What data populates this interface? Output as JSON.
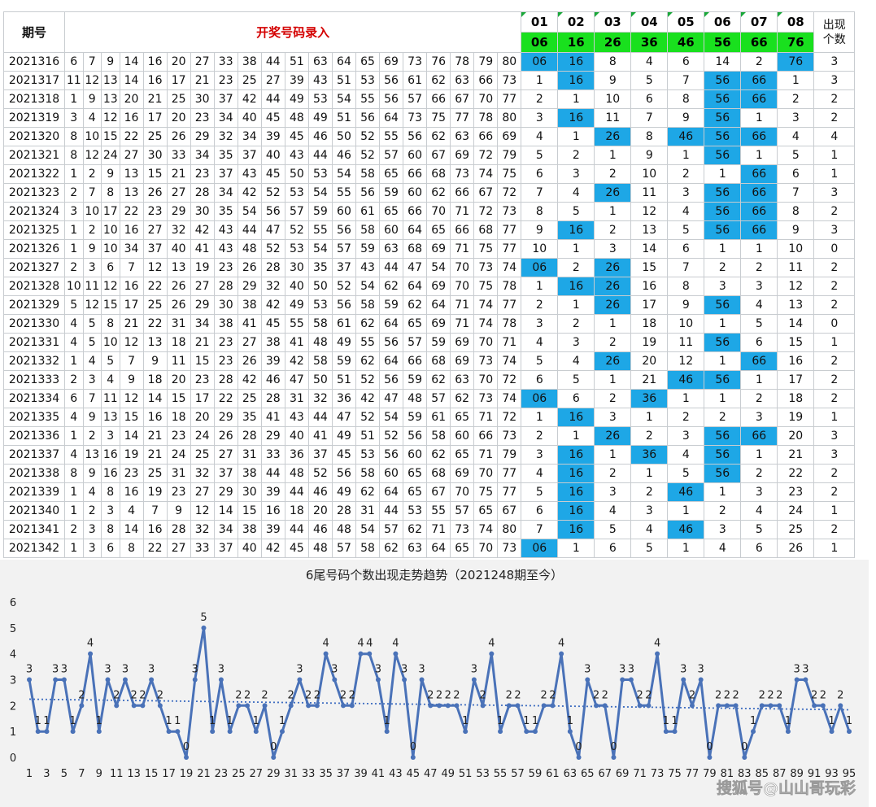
{
  "table": {
    "header_period": "期号",
    "header_input": "开奖号码录入",
    "header_count": "出现个数",
    "positions": [
      "01",
      "02",
      "03",
      "04",
      "05",
      "06",
      "07",
      "08"
    ],
    "tails": [
      "06",
      "16",
      "26",
      "36",
      "46",
      "56",
      "66",
      "76"
    ],
    "rows": [
      {
        "period": "2021316",
        "numbers": [
          "6",
          "7",
          "9",
          "14",
          "16",
          "20",
          "27",
          "33",
          "38",
          "44",
          "51",
          "63",
          "64",
          "65",
          "69",
          "73",
          "76",
          "78",
          "79",
          "80"
        ],
        "marks": [
          "06",
          "16",
          "8",
          "4",
          "6",
          "14",
          "2",
          "76"
        ],
        "count": "3"
      },
      {
        "period": "2021317",
        "numbers": [
          "11",
          "12",
          "13",
          "14",
          "16",
          "17",
          "21",
          "23",
          "25",
          "27",
          "39",
          "43",
          "51",
          "53",
          "56",
          "61",
          "62",
          "63",
          "66",
          "73"
        ],
        "marks": [
          "1",
          "16",
          "9",
          "5",
          "7",
          "56",
          "66",
          "1"
        ],
        "count": "3"
      },
      {
        "period": "2021318",
        "numbers": [
          "1",
          "9",
          "13",
          "20",
          "21",
          "25",
          "30",
          "37",
          "42",
          "44",
          "49",
          "53",
          "54",
          "55",
          "56",
          "57",
          "66",
          "67",
          "70",
          "77"
        ],
        "marks": [
          "2",
          "1",
          "10",
          "6",
          "8",
          "56",
          "66",
          "2"
        ],
        "count": "2"
      },
      {
        "period": "2021319",
        "numbers": [
          "3",
          "4",
          "12",
          "16",
          "17",
          "20",
          "23",
          "34",
          "40",
          "45",
          "48",
          "49",
          "51",
          "56",
          "64",
          "73",
          "75",
          "77",
          "78",
          "80"
        ],
        "marks": [
          "3",
          "16",
          "11",
          "7",
          "9",
          "56",
          "1",
          "3"
        ],
        "count": "2"
      },
      {
        "period": "2021320",
        "numbers": [
          "8",
          "10",
          "15",
          "22",
          "25",
          "26",
          "29",
          "32",
          "34",
          "39",
          "45",
          "46",
          "50",
          "52",
          "55",
          "56",
          "62",
          "63",
          "66",
          "69"
        ],
        "marks": [
          "4",
          "1",
          "26",
          "8",
          "46",
          "56",
          "66",
          "4"
        ],
        "count": "4"
      },
      {
        "period": "2021321",
        "numbers": [
          "8",
          "12",
          "24",
          "27",
          "30",
          "33",
          "34",
          "35",
          "37",
          "40",
          "43",
          "44",
          "46",
          "52",
          "57",
          "60",
          "67",
          "69",
          "72",
          "79"
        ],
        "marks": [
          "5",
          "2",
          "1",
          "9",
          "1",
          "56",
          "1",
          "5"
        ],
        "count": "1"
      },
      {
        "period": "2021322",
        "numbers": [
          "1",
          "2",
          "9",
          "13",
          "15",
          "21",
          "23",
          "37",
          "43",
          "45",
          "50",
          "53",
          "54",
          "58",
          "65",
          "66",
          "68",
          "73",
          "74",
          "75"
        ],
        "marks": [
          "6",
          "3",
          "2",
          "10",
          "2",
          "1",
          "66",
          "6"
        ],
        "count": "1"
      },
      {
        "period": "2021323",
        "numbers": [
          "2",
          "7",
          "8",
          "13",
          "26",
          "27",
          "28",
          "34",
          "42",
          "52",
          "53",
          "54",
          "55",
          "56",
          "59",
          "60",
          "62",
          "66",
          "67",
          "72"
        ],
        "marks": [
          "7",
          "4",
          "26",
          "11",
          "3",
          "56",
          "66",
          "7"
        ],
        "count": "3"
      },
      {
        "period": "2021324",
        "numbers": [
          "3",
          "10",
          "17",
          "22",
          "23",
          "29",
          "30",
          "35",
          "54",
          "56",
          "57",
          "59",
          "60",
          "61",
          "65",
          "66",
          "70",
          "71",
          "72",
          "73"
        ],
        "marks": [
          "8",
          "5",
          "1",
          "12",
          "4",
          "56",
          "66",
          "8"
        ],
        "count": "2"
      },
      {
        "period": "2021325",
        "numbers": [
          "1",
          "2",
          "10",
          "16",
          "27",
          "32",
          "42",
          "43",
          "44",
          "47",
          "52",
          "55",
          "56",
          "58",
          "60",
          "64",
          "65",
          "66",
          "68",
          "77"
        ],
        "marks": [
          "9",
          "16",
          "2",
          "13",
          "5",
          "56",
          "66",
          "9"
        ],
        "count": "3"
      },
      {
        "period": "2021326",
        "numbers": [
          "1",
          "9",
          "10",
          "34",
          "37",
          "40",
          "41",
          "43",
          "48",
          "52",
          "53",
          "54",
          "57",
          "59",
          "63",
          "68",
          "69",
          "71",
          "75",
          "77"
        ],
        "marks": [
          "10",
          "1",
          "3",
          "14",
          "6",
          "1",
          "1",
          "10"
        ],
        "count": "0"
      },
      {
        "period": "2021327",
        "numbers": [
          "2",
          "3",
          "6",
          "7",
          "12",
          "13",
          "19",
          "23",
          "26",
          "28",
          "30",
          "35",
          "37",
          "43",
          "44",
          "47",
          "54",
          "70",
          "73",
          "74"
        ],
        "marks": [
          "06",
          "2",
          "26",
          "15",
          "7",
          "2",
          "2",
          "11"
        ],
        "count": "2"
      },
      {
        "period": "2021328",
        "numbers": [
          "10",
          "11",
          "12",
          "16",
          "22",
          "26",
          "27",
          "28",
          "29",
          "32",
          "40",
          "50",
          "52",
          "54",
          "62",
          "64",
          "69",
          "70",
          "75",
          "78"
        ],
        "marks": [
          "1",
          "16",
          "26",
          "16",
          "8",
          "3",
          "3",
          "12"
        ],
        "count": "2"
      },
      {
        "period": "2021329",
        "numbers": [
          "5",
          "12",
          "15",
          "17",
          "25",
          "26",
          "29",
          "30",
          "38",
          "42",
          "49",
          "53",
          "56",
          "58",
          "59",
          "62",
          "64",
          "71",
          "74",
          "77"
        ],
        "marks": [
          "2",
          "1",
          "26",
          "17",
          "9",
          "56",
          "4",
          "13"
        ],
        "count": "2"
      },
      {
        "period": "2021330",
        "numbers": [
          "4",
          "5",
          "8",
          "21",
          "22",
          "31",
          "34",
          "38",
          "41",
          "45",
          "55",
          "58",
          "61",
          "62",
          "64",
          "65",
          "69",
          "71",
          "74",
          "78"
        ],
        "marks": [
          "3",
          "2",
          "1",
          "18",
          "10",
          "1",
          "5",
          "14"
        ],
        "count": "0"
      },
      {
        "period": "2021331",
        "numbers": [
          "4",
          "5",
          "10",
          "12",
          "13",
          "18",
          "21",
          "23",
          "27",
          "38",
          "41",
          "48",
          "49",
          "55",
          "56",
          "57",
          "59",
          "69",
          "70",
          "71"
        ],
        "marks": [
          "4",
          "3",
          "2",
          "19",
          "11",
          "56",
          "6",
          "15"
        ],
        "count": "1"
      },
      {
        "period": "2021332",
        "numbers": [
          "1",
          "4",
          "5",
          "7",
          "9",
          "11",
          "15",
          "23",
          "26",
          "39",
          "42",
          "58",
          "59",
          "62",
          "64",
          "66",
          "68",
          "69",
          "73",
          "74"
        ],
        "marks": [
          "5",
          "4",
          "26",
          "20",
          "12",
          "1",
          "66",
          "16"
        ],
        "count": "2"
      },
      {
        "period": "2021333",
        "numbers": [
          "2",
          "3",
          "4",
          "9",
          "18",
          "20",
          "23",
          "28",
          "42",
          "46",
          "47",
          "50",
          "51",
          "52",
          "56",
          "59",
          "62",
          "63",
          "70",
          "72"
        ],
        "marks": [
          "6",
          "5",
          "1",
          "21",
          "46",
          "56",
          "1",
          "17"
        ],
        "count": "2"
      },
      {
        "period": "2021334",
        "numbers": [
          "6",
          "7",
          "11",
          "12",
          "14",
          "15",
          "17",
          "22",
          "25",
          "28",
          "31",
          "32",
          "36",
          "42",
          "47",
          "48",
          "57",
          "62",
          "73",
          "74"
        ],
        "marks": [
          "06",
          "6",
          "2",
          "36",
          "1",
          "1",
          "2",
          "18"
        ],
        "count": "2"
      },
      {
        "period": "2021335",
        "numbers": [
          "4",
          "9",
          "13",
          "15",
          "16",
          "18",
          "20",
          "29",
          "35",
          "41",
          "43",
          "44",
          "47",
          "52",
          "54",
          "59",
          "61",
          "65",
          "71",
          "72"
        ],
        "marks": [
          "1",
          "16",
          "3",
          "1",
          "2",
          "2",
          "3",
          "19"
        ],
        "count": "1"
      },
      {
        "period": "2021336",
        "numbers": [
          "1",
          "2",
          "3",
          "14",
          "21",
          "23",
          "24",
          "26",
          "28",
          "29",
          "40",
          "41",
          "49",
          "51",
          "52",
          "56",
          "58",
          "60",
          "66",
          "73"
        ],
        "marks": [
          "2",
          "1",
          "26",
          "2",
          "3",
          "56",
          "66",
          "20"
        ],
        "count": "3"
      },
      {
        "period": "2021337",
        "numbers": [
          "4",
          "13",
          "16",
          "19",
          "21",
          "24",
          "25",
          "27",
          "31",
          "33",
          "36",
          "37",
          "45",
          "53",
          "56",
          "60",
          "62",
          "65",
          "71",
          "79"
        ],
        "marks": [
          "3",
          "16",
          "1",
          "36",
          "4",
          "56",
          "1",
          "21"
        ],
        "count": "3"
      },
      {
        "period": "2021338",
        "numbers": [
          "8",
          "9",
          "16",
          "23",
          "25",
          "31",
          "32",
          "37",
          "38",
          "44",
          "48",
          "52",
          "56",
          "58",
          "60",
          "65",
          "68",
          "69",
          "70",
          "77"
        ],
        "marks": [
          "4",
          "16",
          "2",
          "1",
          "5",
          "56",
          "2",
          "22"
        ],
        "count": "2"
      },
      {
        "period": "2021339",
        "numbers": [
          "1",
          "4",
          "8",
          "16",
          "19",
          "23",
          "27",
          "29",
          "30",
          "39",
          "44",
          "46",
          "49",
          "62",
          "64",
          "65",
          "67",
          "70",
          "75",
          "77"
        ],
        "marks": [
          "5",
          "16",
          "3",
          "2",
          "46",
          "1",
          "3",
          "23"
        ],
        "count": "2"
      },
      {
        "period": "2021340",
        "numbers": [
          "1",
          "2",
          "3",
          "4",
          "7",
          "9",
          "12",
          "14",
          "15",
          "16",
          "18",
          "20",
          "28",
          "31",
          "44",
          "53",
          "55",
          "57",
          "65",
          "67"
        ],
        "marks": [
          "6",
          "16",
          "4",
          "3",
          "1",
          "2",
          "4",
          "24"
        ],
        "count": "1"
      },
      {
        "period": "2021341",
        "numbers": [
          "2",
          "3",
          "8",
          "14",
          "16",
          "28",
          "32",
          "34",
          "38",
          "39",
          "44",
          "46",
          "48",
          "54",
          "57",
          "62",
          "71",
          "73",
          "74",
          "80"
        ],
        "marks": [
          "7",
          "16",
          "5",
          "4",
          "46",
          "3",
          "5",
          "25"
        ],
        "count": "2"
      },
      {
        "period": "2021342",
        "numbers": [
          "1",
          "3",
          "6",
          "8",
          "22",
          "27",
          "33",
          "37",
          "40",
          "42",
          "45",
          "48",
          "57",
          "58",
          "62",
          "63",
          "64",
          "65",
          "70",
          "73"
        ],
        "marks": [
          "06",
          "1",
          "6",
          "5",
          "1",
          "4",
          "6",
          "26"
        ],
        "count": "1"
      }
    ]
  },
  "colors": {
    "hit_cell": "#1ea7e6",
    "tail_header": "#19e01e",
    "input_header_text": "#d40000",
    "line": "#4a72b8",
    "trend": "#3d6cc0",
    "chart_bg": "#f2f2f2"
  },
  "watermark": "搜狐号@山山哥玩彩",
  "chart_data": {
    "type": "line",
    "title": "6尾号码个数出现走势趋势（2021248期至今）",
    "x": [
      1,
      2,
      3,
      4,
      5,
      6,
      7,
      8,
      9,
      10,
      11,
      12,
      13,
      14,
      15,
      16,
      17,
      18,
      19,
      20,
      21,
      22,
      23,
      24,
      25,
      26,
      27,
      28,
      29,
      30,
      31,
      32,
      33,
      34,
      35,
      36,
      37,
      38,
      39,
      40,
      41,
      42,
      43,
      44,
      45,
      46,
      47,
      48,
      49,
      50,
      51,
      52,
      53,
      54,
      55,
      56,
      57,
      58,
      59,
      60,
      61,
      62,
      63,
      64,
      65,
      66,
      67,
      68,
      69,
      70,
      71,
      72,
      73,
      74,
      75,
      76,
      77,
      78,
      79,
      80,
      81,
      82,
      83,
      84,
      85,
      86,
      87,
      88,
      89,
      90,
      91,
      92,
      93,
      94,
      95
    ],
    "xticks": [
      1,
      3,
      5,
      7,
      9,
      11,
      13,
      15,
      17,
      19,
      21,
      23,
      25,
      27,
      29,
      31,
      33,
      35,
      37,
      39,
      41,
      43,
      45,
      47,
      49,
      51,
      53,
      55,
      57,
      59,
      61,
      63,
      65,
      67,
      69,
      71,
      73,
      75,
      77,
      79,
      81,
      83,
      85,
      87,
      89,
      91,
      93,
      95
    ],
    "series": [
      {
        "values": [
          3,
          1,
          1,
          3,
          3,
          1,
          2,
          4,
          1,
          3,
          2,
          3,
          2,
          2,
          3,
          2,
          1,
          1,
          0,
          3,
          5,
          1,
          3,
          1,
          2,
          2,
          1,
          2,
          0,
          1,
          2,
          3,
          2,
          2,
          4,
          3,
          2,
          2,
          4,
          4,
          3,
          1,
          4,
          3,
          0,
          3,
          2,
          2,
          2,
          2,
          1,
          3,
          2,
          4,
          1,
          2,
          2,
          1,
          1,
          2,
          2,
          4,
          1,
          0,
          3,
          2,
          2,
          0,
          3,
          3,
          2,
          2,
          4,
          1,
          1,
          3,
          2,
          3,
          0,
          2,
          2,
          2,
          0,
          1,
          2,
          2,
          2,
          1,
          3,
          3,
          2,
          2,
          1,
          2,
          1
        ]
      }
    ],
    "trendline": {
      "type": "linear",
      "dotted": true
    },
    "xlabel": "",
    "ylabel": "",
    "ylim": [
      0,
      6
    ],
    "yticks": [
      0,
      1,
      2,
      3,
      4,
      5,
      6
    ],
    "grid": false,
    "legend": "none"
  }
}
